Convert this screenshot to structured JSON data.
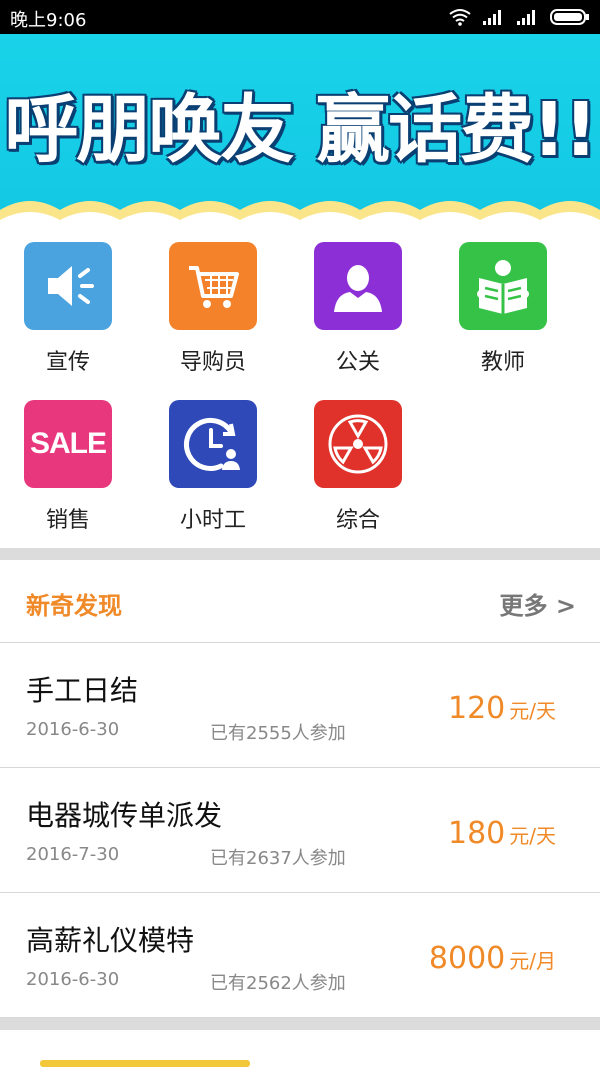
{
  "status": {
    "time": "晚上9:06"
  },
  "banner": {
    "title": "呼朋唤友 赢话费!!"
  },
  "categories": [
    {
      "label": "宣传",
      "icon": "speaker-icon",
      "color": "#4aa3df"
    },
    {
      "label": "导购员",
      "icon": "shopping-cart-icon",
      "color": "#f3822a"
    },
    {
      "label": "公关",
      "icon": "person-icon",
      "color": "#8d2fd6"
    },
    {
      "label": "教师",
      "icon": "reading-icon",
      "color": "#35c247"
    },
    {
      "label": "销售",
      "icon": "sale-icon",
      "color": "#e8377d",
      "badge": "SALE"
    },
    {
      "label": "小时工",
      "icon": "clock-user-icon",
      "color": "#2f49b9"
    },
    {
      "label": "综合",
      "icon": "radiation-icon",
      "color": "#e0322a"
    }
  ],
  "section": {
    "title": "新奇发现",
    "more": "更多 >"
  },
  "jobs": [
    {
      "name": "手工日结",
      "date": "2016-6-30",
      "count": "已有2555人参加",
      "price": "120",
      "unit": "元/天"
    },
    {
      "name": "电器城传单派发",
      "date": "2016-7-30",
      "count": "已有2637人参加",
      "price": "180",
      "unit": "元/天"
    },
    {
      "name": "高薪礼仪模特",
      "date": "2016-6-30",
      "count": "已有2562人参加",
      "price": "8000",
      "unit": "元/月"
    }
  ]
}
